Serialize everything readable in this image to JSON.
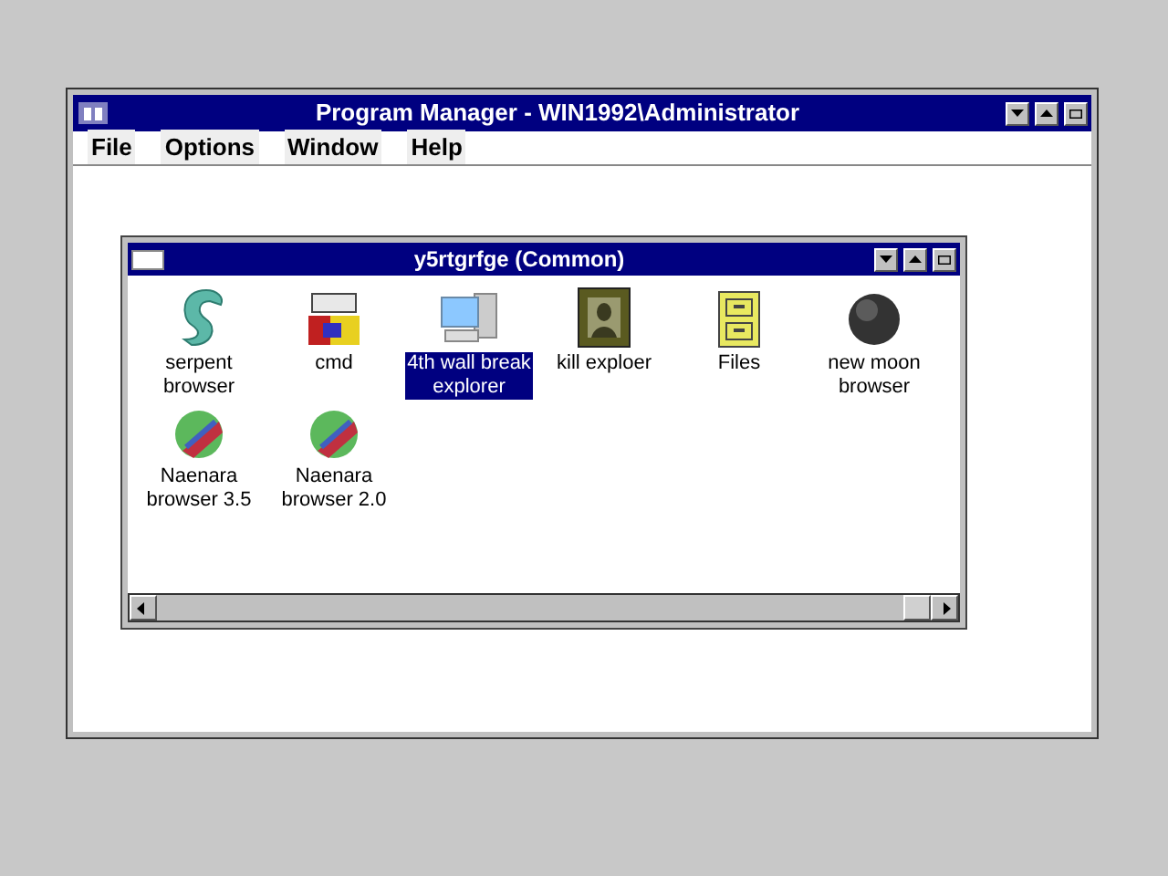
{
  "window": {
    "title": "Program Manager - WIN1992\\Administrator"
  },
  "menu": [
    "File",
    "Options",
    "Window",
    "Help"
  ],
  "group": {
    "title": "y5rtgrfge (Common)",
    "items": [
      {
        "kind": "serpent",
        "label": "serpent browser",
        "selected": false
      },
      {
        "kind": "msdos",
        "label": "cmd",
        "selected": false
      },
      {
        "kind": "computer",
        "label": "4th wall break explorer",
        "selected": true
      },
      {
        "kind": "portrait",
        "label": "kill exploer",
        "selected": false
      },
      {
        "kind": "cabinet",
        "label": "Files",
        "selected": false
      },
      {
        "kind": "moon",
        "label": "new moon browser",
        "selected": false
      },
      {
        "kind": "globe",
        "label": "Naenara browser 3.5",
        "selected": false
      },
      {
        "kind": "globe",
        "label": "Naenara browser 2.0",
        "selected": false
      }
    ]
  }
}
